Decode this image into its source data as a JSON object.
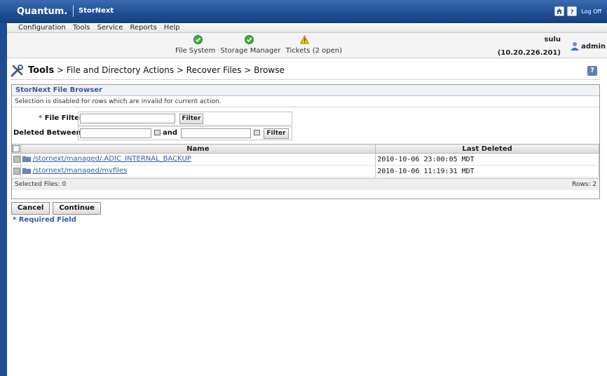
{
  "header": {
    "brand": "Quantum.",
    "product": "StorNext",
    "logoff": "Log Off"
  },
  "menu": [
    "Configuration",
    "Tools",
    "Service",
    "Reports",
    "Help"
  ],
  "status": {
    "items": [
      {
        "label": "File System",
        "state": "ok"
      },
      {
        "label": "Storage Manager",
        "state": "ok"
      },
      {
        "label": "Tickets (2 open)",
        "state": "warning"
      }
    ],
    "host": "sulu",
    "ip": "(10.20.226.201)",
    "user": "admin"
  },
  "breadcrumb": {
    "root": "Tools",
    "path": " > File and Directory Actions > Recover Files > Browse"
  },
  "panel": {
    "title": "StorNext File Browser",
    "note": "Selection is disabled for rows which are invalid for current action.",
    "file_filter_label": "File Filter",
    "required_mark": "*",
    "deleted_between_label": "Deleted Between",
    "and_label": "and",
    "filter_button": "Filter",
    "file_filter_value": "",
    "date_from_value": "",
    "date_to_value": ""
  },
  "table": {
    "columns": [
      "Name",
      "Last Deleted"
    ],
    "rows": [
      {
        "name": "/stornext/managed/.ADIC_INTERNAL_BACKUP",
        "deleted": "2010-10-06 23:00:05 MDT"
      },
      {
        "name": "/stornext/managed/myfiles",
        "deleted": "2010-10-06 11:19:31 MDT"
      }
    ],
    "selected": "Selected Files: 0",
    "rows_count": "Rows: 2"
  },
  "actions": {
    "cancel": "Cancel",
    "continue": "Continue"
  },
  "required_note": "* Required Field",
  "colors": {
    "brand_blue": "#1f4d94",
    "link": "#2f5dad",
    "ok": "#3fae3f",
    "warning": "#f2c200"
  }
}
